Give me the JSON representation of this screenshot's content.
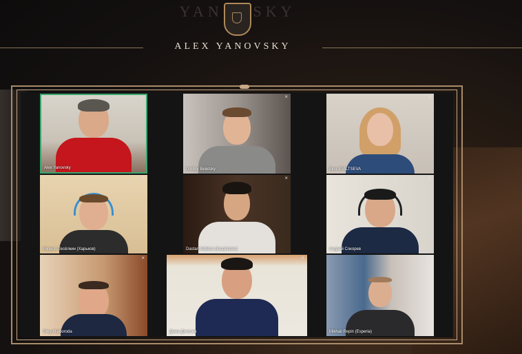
{
  "brand": {
    "watermark": "YANOVSKY",
    "title": "ALEX YANOVSKY"
  },
  "participants": [
    {
      "name": "Alex Yanovsky",
      "active": true
    },
    {
      "name": "Dmitriy Beletsky",
      "active": false
    },
    {
      "name": "Irina IMALTSEVA",
      "active": false
    },
    {
      "name": "Кирилл Тесёлкин (Харьков)",
      "active": false
    },
    {
      "name": "Dastan Sabitov (Kazahstan)",
      "active": false
    },
    {
      "name": "Андрей Сокорев",
      "active": false
    },
    {
      "name": "Oleg Maiboroda",
      "active": false
    },
    {
      "name": "Дима Дигалев",
      "active": false
    },
    {
      "name": "Mikhail  Repin (Esperia)",
      "active": false
    }
  ],
  "close_glyph": "×",
  "colors": {
    "frame": "#a98c6a",
    "active_border": "#3aa86e",
    "headset": "#3a8fd0"
  }
}
